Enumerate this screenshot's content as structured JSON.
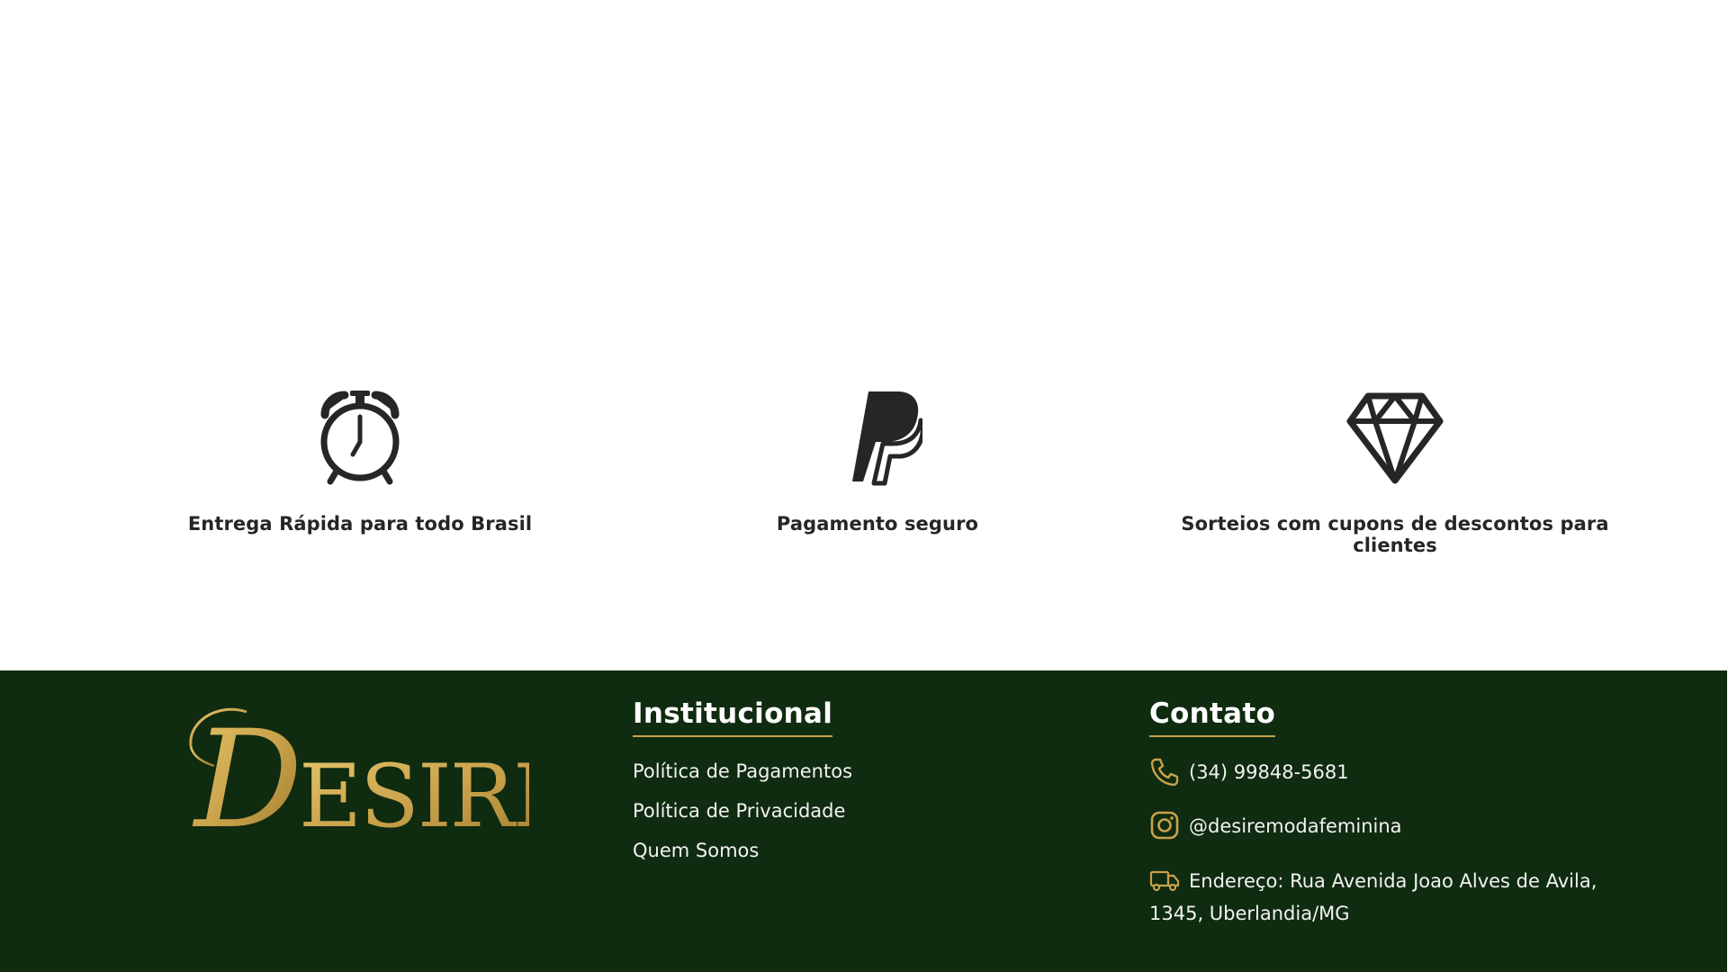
{
  "features": [
    {
      "icon": "alarm-clock-icon",
      "label": "Entrega Rápida para todo Brasil"
    },
    {
      "icon": "paypal-icon",
      "label": "Pagamento seguro"
    },
    {
      "icon": "diamond-icon",
      "label": "Sorteios com cupons de descontos para clientes"
    }
  ],
  "footer": {
    "logo_text": "DESIRE",
    "institucional": {
      "title": "Institucional",
      "links": [
        "Política de Pagamentos",
        "Política de Privacidade",
        "Quem Somos"
      ]
    },
    "contato": {
      "title": "Contato",
      "phone": "(34) 99848-5681",
      "instagram": "@desiremodafeminina",
      "address": "Endereço: Rua Avenida Joao Alves de Avila, 1345, Uberlandia/MG"
    }
  },
  "colors": {
    "footer_bg": "#0f2b10",
    "gold": "#c9a14a",
    "icon_dark": "#262626",
    "text_light": "#f2f2f2"
  }
}
